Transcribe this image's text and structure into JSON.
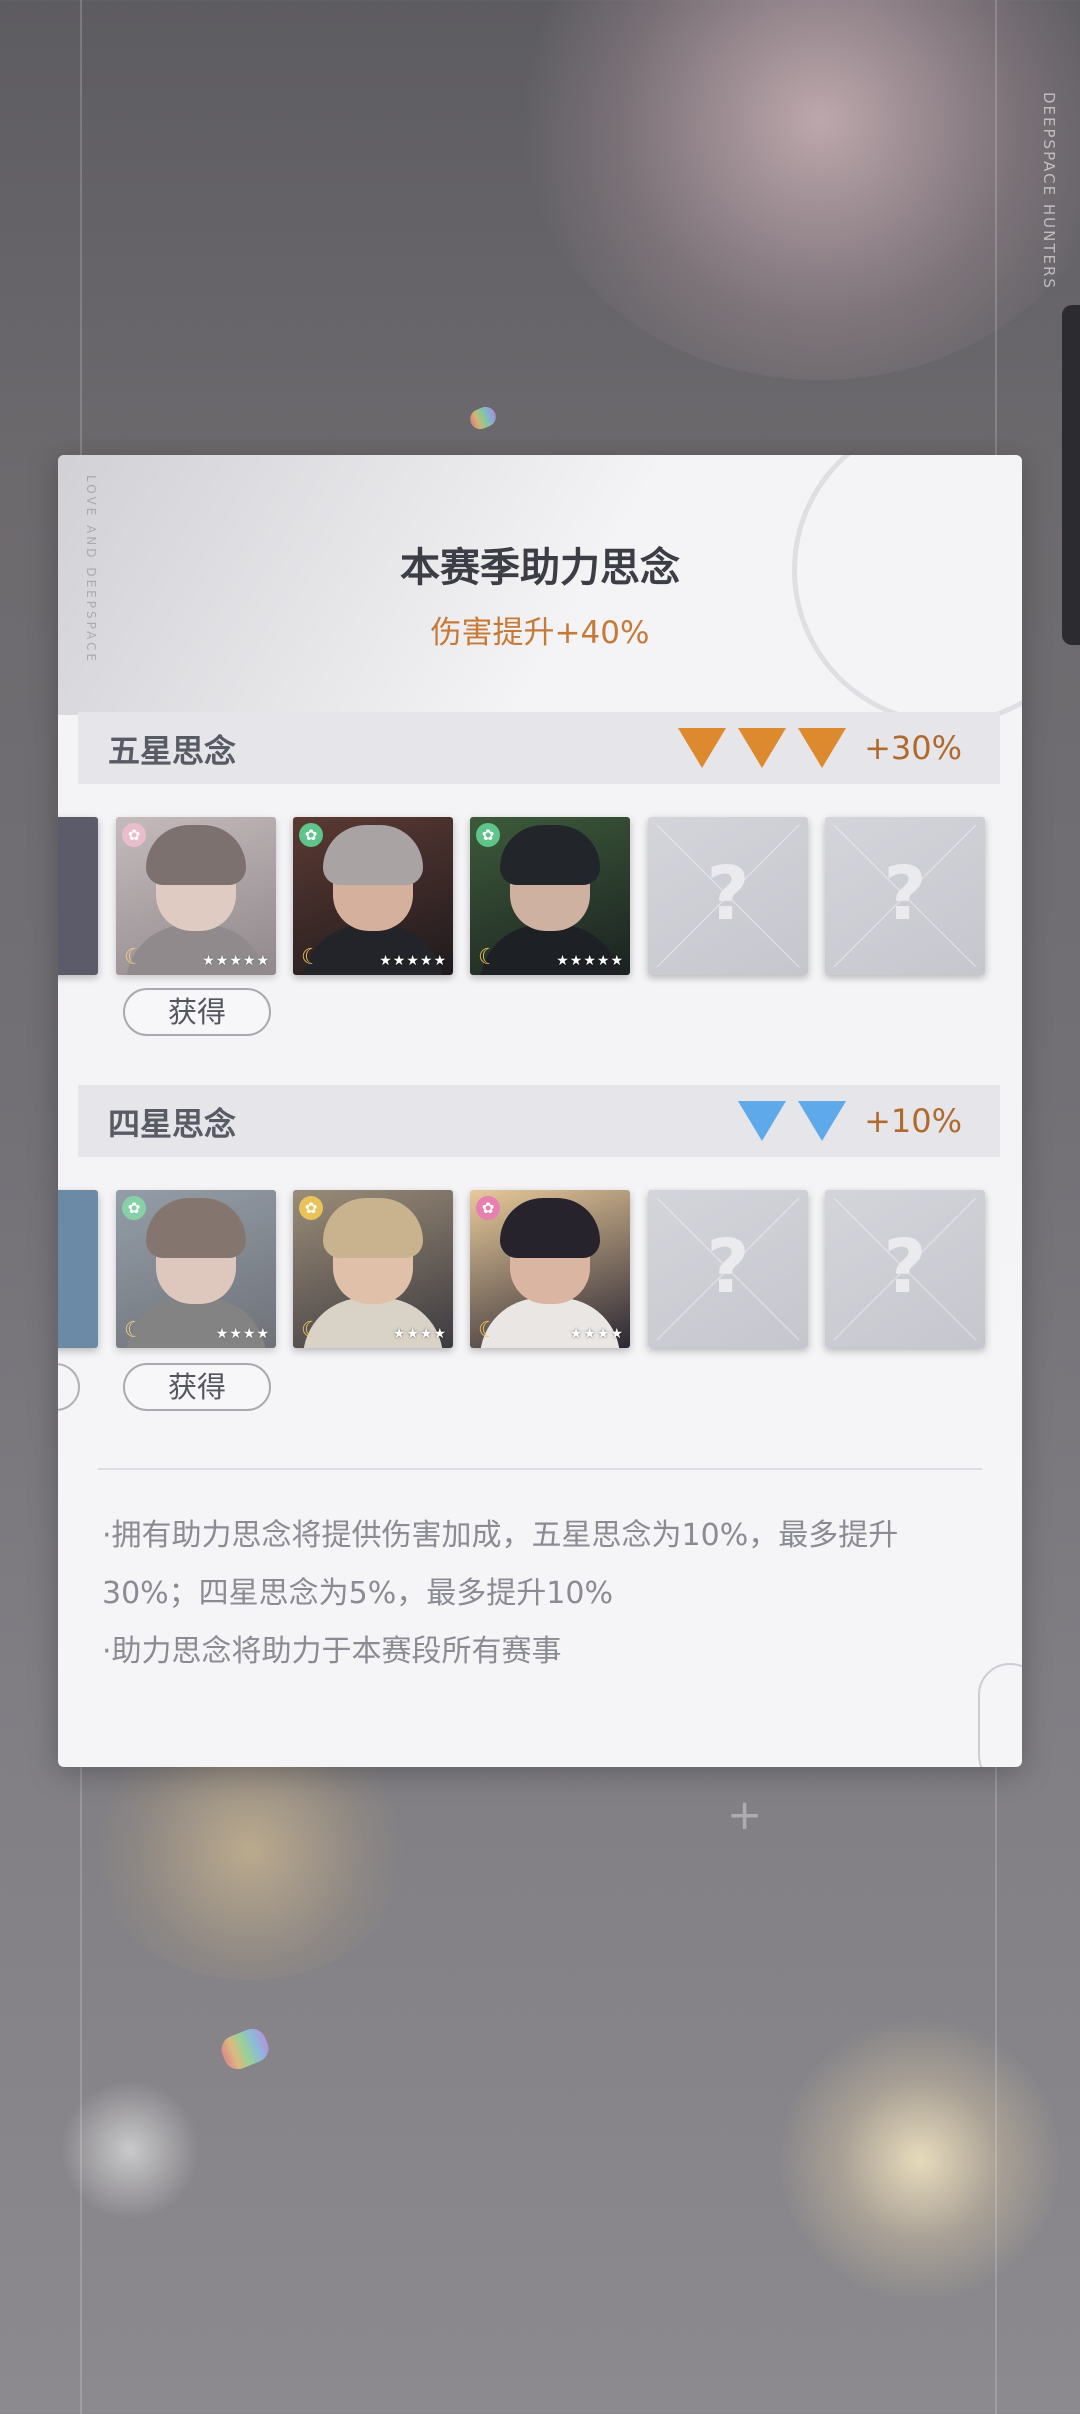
{
  "background": {
    "vertical_text": "DEEPSPACE HUNTERS"
  },
  "dialog": {
    "title": "本赛季助力思念",
    "subtitle": "伤害提升+40%",
    "corner_text": "LOVE AND DEEPSPACE",
    "five_star": {
      "label": "五星思念",
      "bonus": "+30%",
      "badge_color": "#dd8a2e",
      "badge_count": 3,
      "get_button": "获得",
      "cards": [
        {
          "state": "faded",
          "gem_color": "#e6a8bd",
          "stars": "★★★★★",
          "tone": "#6b5f62"
        },
        {
          "state": "owned",
          "gem_color": "#5ec48a",
          "stars": "★★★★★",
          "tone": "#3a2e2d"
        },
        {
          "state": "owned",
          "gem_color": "#5ec48a",
          "stars": "★★★★★",
          "tone": "#263026"
        },
        {
          "state": "locked",
          "mark": "?"
        },
        {
          "state": "locked",
          "mark": "?"
        }
      ]
    },
    "four_star": {
      "label": "四星思念",
      "bonus": "+10%",
      "badge_color": "#5ea9e9",
      "badge_count": 2,
      "get_button": "获得",
      "cards": [
        {
          "state": "faded",
          "gem_color": "#5ec48a",
          "stars": "★★★★",
          "tone": "#5a5a66"
        },
        {
          "state": "owned",
          "gem_color": "#e9c35a",
          "stars": "★★★★",
          "tone": "#6e5e4c"
        },
        {
          "state": "owned",
          "gem_color": "#e77fb0",
          "stars": "★★★★",
          "tone": "#3a3340"
        },
        {
          "state": "locked",
          "mark": "?"
        },
        {
          "state": "locked",
          "mark": "?"
        }
      ]
    },
    "notes": [
      "·拥有助力思念将提供伤害加成，五星思念为10%，最多提升30%；四星思念为5%，最多提升10%",
      "·助力思念将助力于本赛段所有赛事"
    ]
  }
}
